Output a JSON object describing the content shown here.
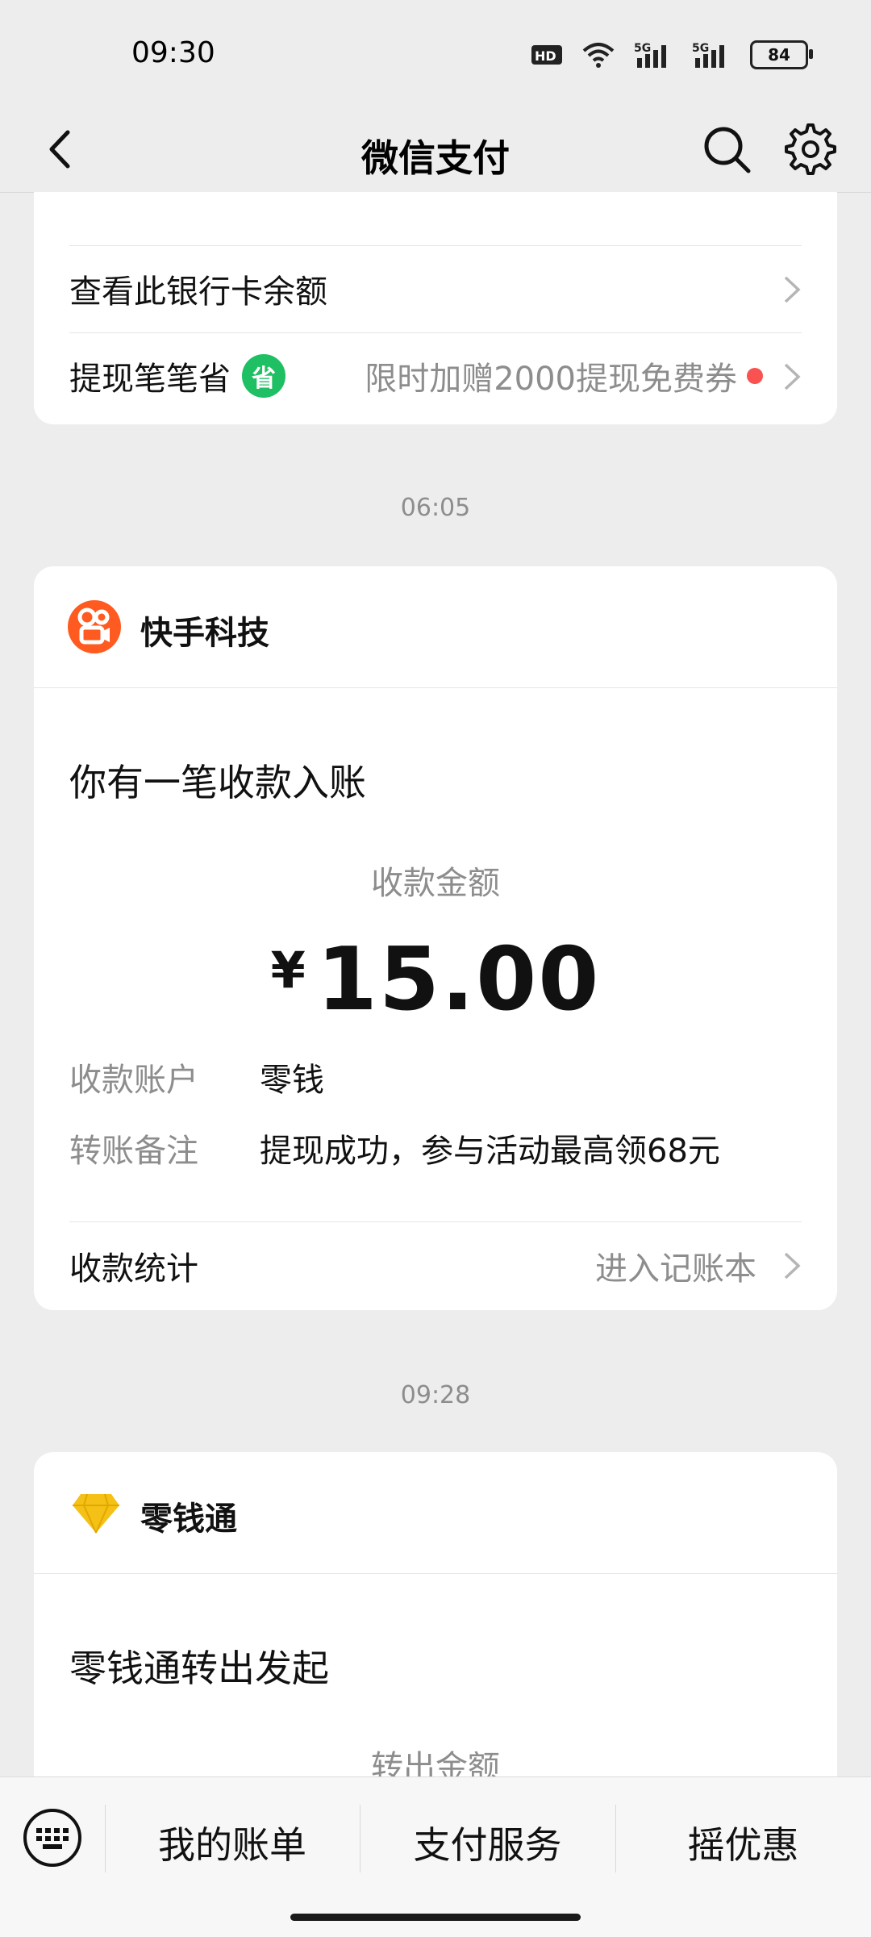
{
  "status": {
    "time": "09:30",
    "battery": "84"
  },
  "header": {
    "title": "微信支付"
  },
  "bank_card": {
    "balance_label": "查看此银行卡余额",
    "withdraw_label": "提现笔笔省",
    "sheng_badge": "省",
    "promo": "限时加赠2000提现免费券"
  },
  "msg1": {
    "time": "06:05",
    "brand": "快手科技",
    "title": "你有一笔收款入账",
    "amount_label": "收款金额",
    "currency": "¥",
    "amount": "15.00",
    "account_key": "收款账户",
    "account_val": "零钱",
    "remark_key": "转账备注",
    "remark_val": "提现成功，参与活动最高领68元",
    "stat_label": "收款统计",
    "stat_action": "进入记账本"
  },
  "msg2": {
    "time": "09:28",
    "brand": "零钱通",
    "title": "零钱通转出发起",
    "amount_label": "转出金额"
  },
  "bottom_tabs": [
    "我的账单",
    "支付服务",
    "摇优惠"
  ],
  "colors": {
    "green": "#1fbf63",
    "red_dot": "#fa5151",
    "kuaishou": "#ff5a1f",
    "diamond": "#f5c116"
  }
}
